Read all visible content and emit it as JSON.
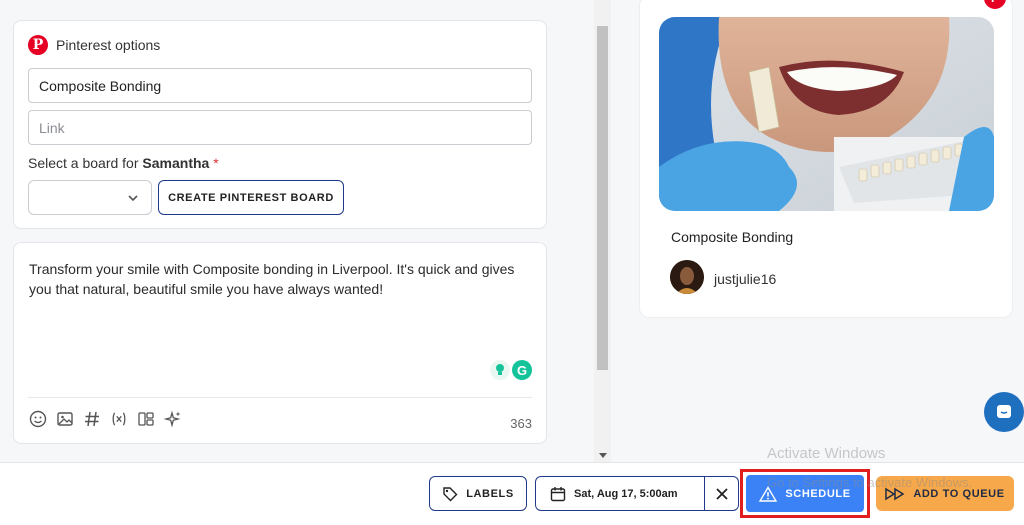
{
  "pinterest": {
    "header": "Pinterest options",
    "title_value": "Composite Bonding",
    "link_placeholder": "Link",
    "board_label_prefix": "Select a board for ",
    "board_account": "Samantha",
    "required_mark": "*",
    "create_board_label": "CREATE PINTEREST BOARD"
  },
  "caption": {
    "text": "Transform your smile with Composite bonding in Liverpool. It's quick and gives you that natural, beautiful smile you have always wanted!",
    "char_count": "363",
    "toolbar_icons": [
      "emoji-icon",
      "image-icon",
      "hashtag-icon",
      "variable-icon",
      "layout-icon",
      "ai-sparkle-icon"
    ]
  },
  "preview": {
    "title": "Composite Bonding",
    "username": "justjulie16"
  },
  "bottom_bar": {
    "labels_label": "LABELS",
    "date_label": "Sat, Aug 17, 5:00am",
    "schedule_label": "SCHEDULE",
    "queue_label": "ADD TO QUEUE"
  },
  "watermark": {
    "line1": "Activate Windows",
    "line2": "Go to Settings to activate Windows."
  },
  "colors": {
    "pinterest_red": "#e60023",
    "primary_blue": "#3b82f6",
    "outline_navy": "#1f3a8a",
    "queue_orange": "#f7a84a",
    "highlight_red": "#e01e1e",
    "grammarly_green": "#15c39a"
  }
}
